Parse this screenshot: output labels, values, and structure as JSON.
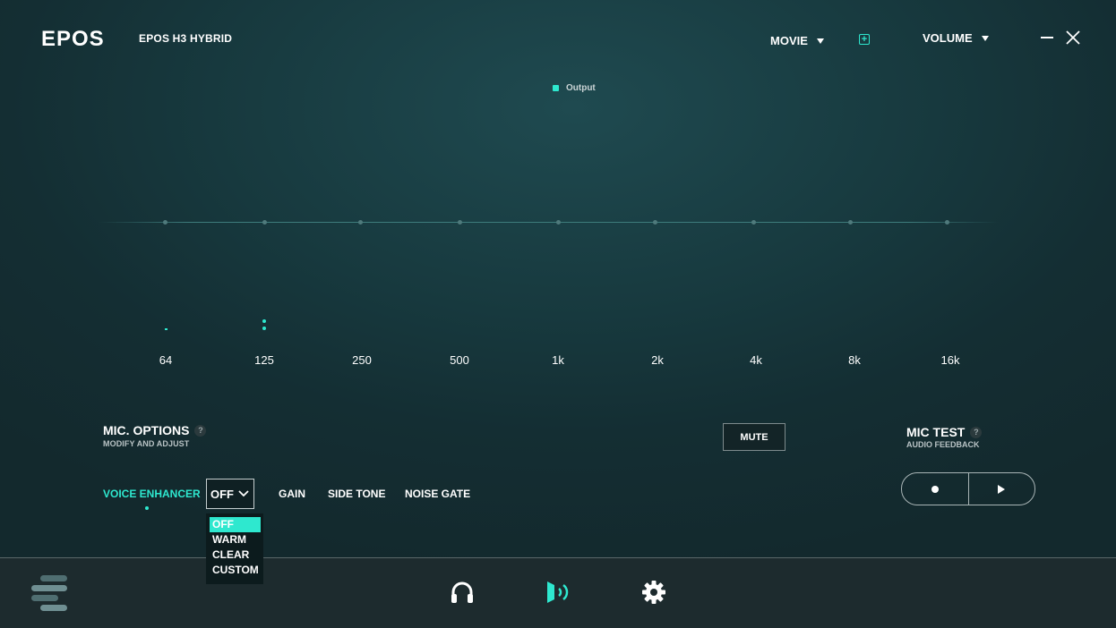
{
  "app": {
    "logo": "EPOS",
    "device_name": "EPOS H3 HYBRID"
  },
  "header": {
    "preset_label": "MOVIE",
    "volume_label": "VOLUME",
    "icons": [
      "add-preset-icon",
      "minimize-icon",
      "close-icon",
      "chevron-down-icon"
    ]
  },
  "equalizer": {
    "legend": "Output",
    "frequencies": [
      "64",
      "125",
      "250",
      "500",
      "1k",
      "2k",
      "4k",
      "8k",
      "16k"
    ],
    "gains": [
      0,
      0,
      0,
      0,
      0,
      0,
      0,
      0,
      0
    ]
  },
  "mic_options": {
    "title": "MIC. OPTIONS",
    "subtitle": "MODIFY AND ADJUST",
    "tabs": [
      "VOICE ENHANCER",
      "GAIN",
      "SIDE TONE",
      "NOISE GATE"
    ],
    "active_tab": "VOICE ENHANCER",
    "voice_enhancer": {
      "selected": "OFF",
      "options": [
        "OFF",
        "WARM",
        "CLEAR",
        "CUSTOM"
      ]
    },
    "mute_label": "MUTE"
  },
  "mic_test": {
    "title": "MIC TEST",
    "subtitle": "AUDIO FEEDBACK"
  },
  "footer": {
    "icons": [
      "menu-icon",
      "headphones-icon",
      "microphone-icon",
      "settings-icon"
    ],
    "active": "microphone-icon"
  },
  "colors": {
    "accent": "#2ee8cf",
    "background": "#17393e",
    "footer": "#1d2b2e"
  }
}
